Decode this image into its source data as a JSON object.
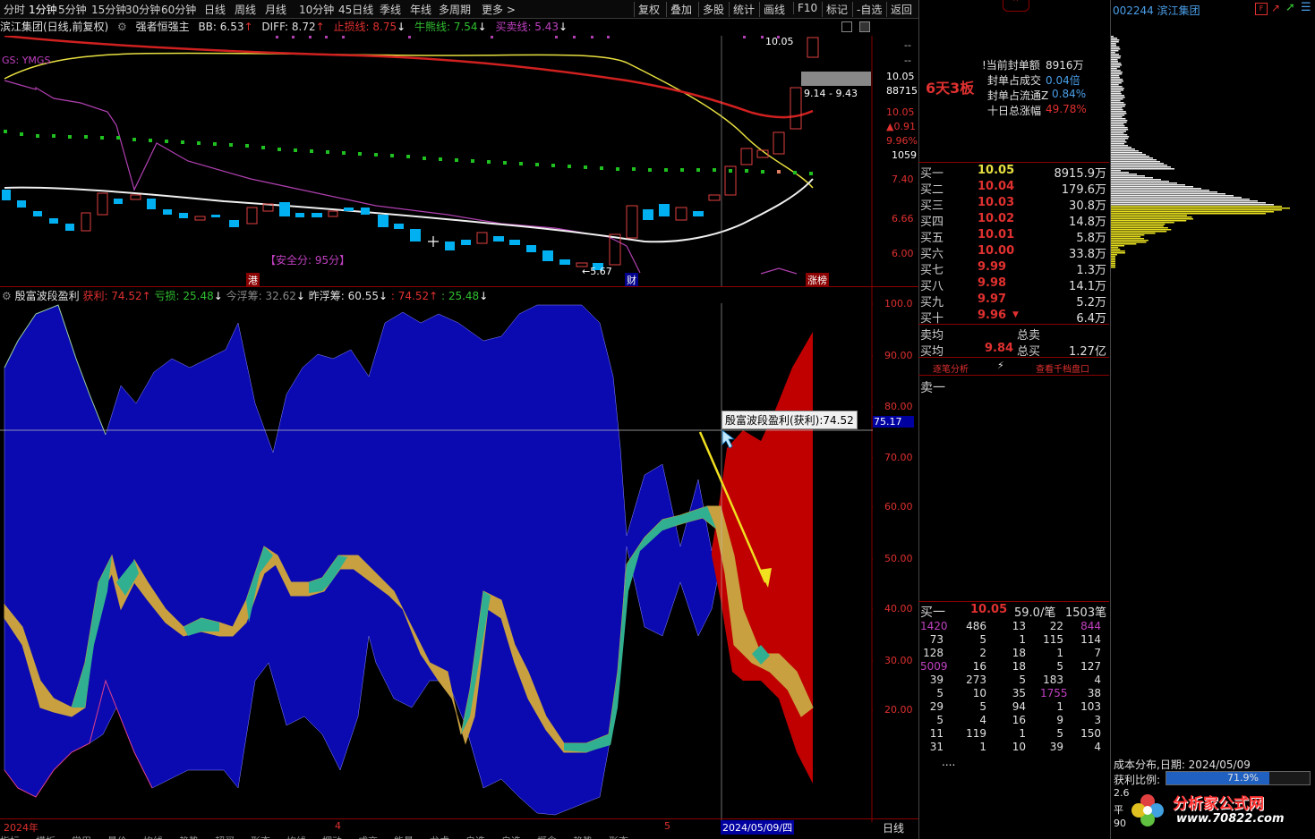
{
  "topbar": {
    "left_items": [
      "分时",
      "1分钟",
      "5分钟",
      "15分钟",
      "30分钟",
      "60分钟",
      "日线",
      "周线",
      "月线",
      "10分钟",
      "45日线",
      "季线",
      "年线",
      "多周期",
      "更多 >"
    ],
    "right_items": [
      "复权",
      "叠加",
      "多股",
      "统计",
      "画线",
      "F10",
      "标记",
      "-自选",
      "返回"
    ]
  },
  "info": {
    "title": "滨江集团(日线,前复权)",
    "indicator": "强者恒强主",
    "bb": "BB: 6.53",
    "diff": "DIFF: 8.72",
    "stop": "止损线: 8.75",
    "bull": "牛熊线: 7.54",
    "trade": "买卖线: 5.43"
  },
  "main_chart": {
    "ygs_label": "GS: YMGS",
    "price_axis": [
      "10.05",
      "88715",
      "10.05",
      "▲0.91",
      "9.96%",
      "1059",
      "7.40",
      "6.66",
      "6.00"
    ],
    "high_label": "10.05",
    "range_label": "9.14 - 9.43",
    "low_label": "←5.67",
    "safety": "【安全分: 95分】",
    "marker_gang": "港",
    "marker_cai": "财",
    "marker_zhangbang": "涨榜",
    "dash1": "--",
    "dash2": "--"
  },
  "indicator": {
    "name": "殷富波段盈利",
    "profit": "获利: 74.52",
    "loss": "亏损: 25.48",
    "today_float": "今浮筹: 32.62",
    "yesterday_float": "昨浮筹: 60.55",
    "v1": ": 74.52",
    "v2": ": 25.48",
    "axis": [
      "100.0",
      "90.00",
      "80.00",
      "70.00",
      "60.00",
      "50.00",
      "40.00",
      "30.00",
      "20.00"
    ],
    "crosshair_value": "75.17",
    "tooltip": "殷富波段盈利(获利):74.52"
  },
  "dates": {
    "year": "2024年",
    "m4": "4",
    "m5": "5",
    "current": "2024/05/09/四",
    "period": "日线"
  },
  "quote": {
    "code_name": "002244 滨江集团",
    "boards": "6天3板",
    "seal_amount_label": "!当前封单额",
    "seal_amount": "8916万",
    "seal_ratio_label": "封单占成交",
    "seal_ratio": "0.04倍",
    "seal_float_label": "封单占流通Z",
    "seal_float": "0.84%",
    "ten_day_label": "十日总涨幅",
    "ten_day": "49.78%",
    "bids": [
      {
        "label": "买一",
        "price": "10.05",
        "vol": "8915.9万"
      },
      {
        "label": "买二",
        "price": "10.04",
        "vol": "179.6万"
      },
      {
        "label": "买三",
        "price": "10.03",
        "vol": "30.8万"
      },
      {
        "label": "买四",
        "price": "10.02",
        "vol": "14.8万"
      },
      {
        "label": "买五",
        "price": "10.01",
        "vol": "5.8万"
      },
      {
        "label": "买六",
        "price": "10.00",
        "vol": "33.8万"
      },
      {
        "label": "买七",
        "price": "9.99",
        "vol": "1.3万"
      },
      {
        "label": "买八",
        "price": "9.98",
        "vol": "14.1万"
      },
      {
        "label": "买九",
        "price": "9.97",
        "vol": "5.2万"
      },
      {
        "label": "买十",
        "price": "9.96",
        "vol": "6.4万"
      }
    ],
    "sell_avg_label": "卖均",
    "total_sell_label": "总卖",
    "buy_avg_label": "买均",
    "buy_avg": "9.84",
    "total_buy_label": "总买",
    "total_buy": "1.27亿",
    "link1": "逐笔分析",
    "link2": "查看千档盘口",
    "sell1": "卖一",
    "queue_label": "买一",
    "queue_price": "10.05",
    "queue_per": "59.0/笔",
    "queue_count": "1503笔",
    "queue": [
      [
        "1420",
        "486",
        "13",
        "22",
        "844"
      ],
      [
        "73",
        "5",
        "1",
        "115",
        "114"
      ],
      [
        "128",
        "2",
        "18",
        "1",
        "7"
      ],
      [
        "5009",
        "16",
        "18",
        "5",
        "127"
      ],
      [
        "39",
        "273",
        "5",
        "183",
        "4"
      ],
      [
        "5",
        "10",
        "35",
        "1755",
        "38"
      ],
      [
        "29",
        "5",
        "94",
        "1",
        "103"
      ],
      [
        "5",
        "4",
        "16",
        "9",
        "3"
      ],
      [
        "11",
        "119",
        "1",
        "5",
        "150"
      ],
      [
        "31",
        "1",
        "10",
        "39",
        "4"
      ]
    ],
    "ellipsis": "....",
    "cost_title": "成本分布,日期: 2024/05/09",
    "profit_ratio_label": "获利比例:",
    "profit_ratio": "71.9%",
    "watermark": "分析家公式网",
    "watermark_url": "www.70822.com",
    "cost_extra1": "2.6",
    "cost_extra2": "平",
    "cost_extra3": "90"
  },
  "bottom_tabs": [
    "指标",
    "模板",
    "常用",
    "量价",
    "均线",
    "趋势",
    "超买",
    "形态",
    "均线",
    "摆动",
    "成交",
    "能量",
    "龙虎",
    "自选",
    "自选",
    "概念",
    "趋势",
    "形态"
  ]
}
